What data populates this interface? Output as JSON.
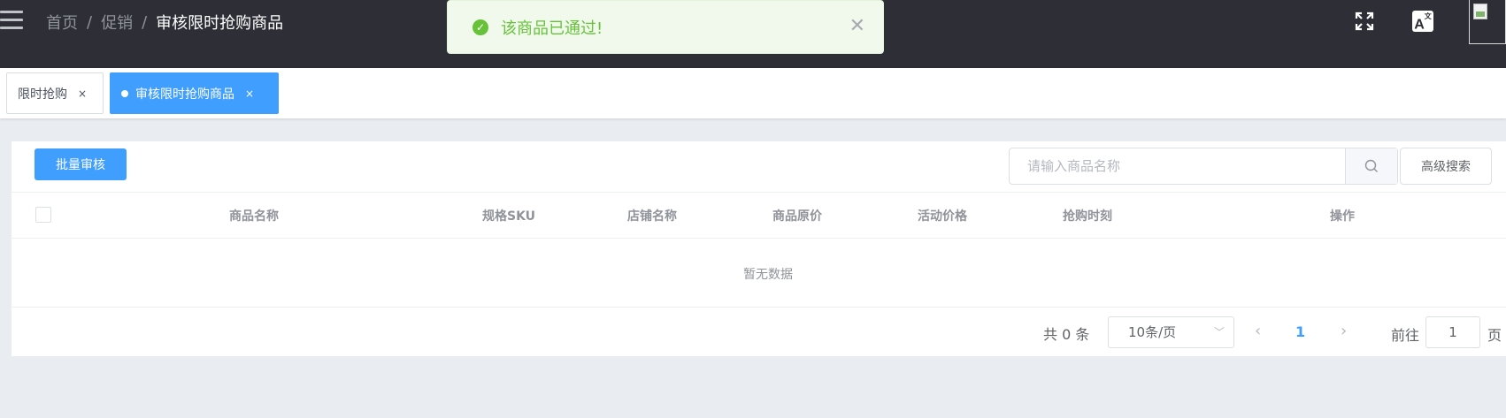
{
  "header": {
    "breadcrumb": [
      "首页",
      "促销",
      "审核限时抢购商品"
    ],
    "separator": "/",
    "lang_label": "A"
  },
  "toast": {
    "message": "该商品已通过!",
    "type": "success",
    "color": "#67c23a"
  },
  "tags": [
    {
      "label": "限时抢购",
      "active": false
    },
    {
      "label": "审核限时抢购商品",
      "active": true
    }
  ],
  "toolbar": {
    "batch_label": "批量审核",
    "search_placeholder": "请输入商品名称",
    "search_value": "",
    "advanced_label": "高级搜索"
  },
  "table": {
    "columns": [
      "商品名称",
      "规格SKU",
      "店铺名称",
      "商品原价",
      "活动价格",
      "抢购时刻",
      "操作"
    ],
    "rows": [],
    "empty_text": "暂无数据"
  },
  "pagination": {
    "total_text": "共 0 条",
    "page_size": "10条/页",
    "current_page": "1",
    "goto_label": "前往",
    "goto_value": "1",
    "page_label": "页"
  },
  "colors": {
    "primary": "#409eff",
    "header_bg": "#2e2e37",
    "success": "#67c23a"
  }
}
